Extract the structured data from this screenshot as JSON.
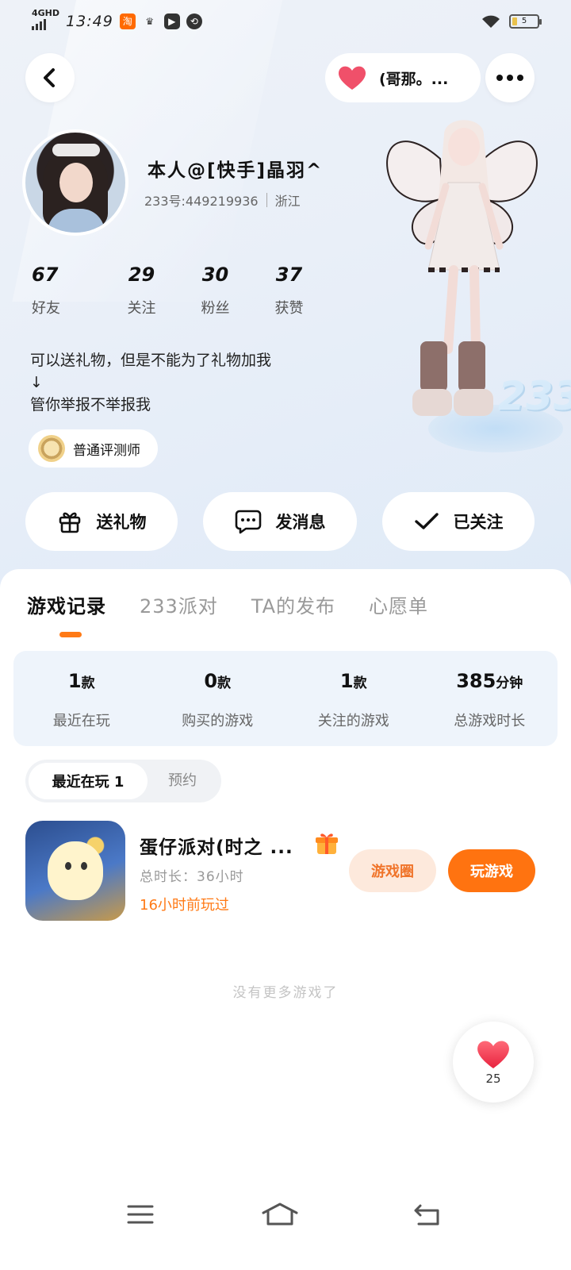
{
  "status_bar": {
    "network": "4GHD",
    "time": "13:49",
    "battery_level": "5"
  },
  "header": {
    "relation_label": "(哥那。...",
    "more_label": "•••"
  },
  "profile": {
    "name": "本人@[快手]晶羽^",
    "uid": "233号:449219936",
    "location": "浙江",
    "stats": [
      {
        "num": "67",
        "label": "好友"
      },
      {
        "num": "29",
        "label": "关注"
      },
      {
        "num": "30",
        "label": "粉丝"
      },
      {
        "num": "37",
        "label": "获赞"
      }
    ],
    "bio_line1": "可以送礼物，但是不能为了礼物加我",
    "bio_line2": "↓",
    "bio_line3": "管你举报不举报我",
    "badge": "普通评测师",
    "deco_text": "233"
  },
  "actions": {
    "gift": "送礼物",
    "message": "发消息",
    "followed": "已关注"
  },
  "tabs": [
    "游戏记录",
    "233派对",
    "TA的发布",
    "心愿单"
  ],
  "summary": [
    {
      "value": "1",
      "unit": "款",
      "label": "最近在玩"
    },
    {
      "value": "0",
      "unit": "款",
      "label": "购买的游戏"
    },
    {
      "value": "1",
      "unit": "款",
      "label": "关注的游戏"
    },
    {
      "value": "385",
      "unit": "分钟",
      "label": "总游戏时长"
    }
  ],
  "segment": {
    "active": "最近在玩 1",
    "inactive": "预约"
  },
  "game": {
    "title": "蛋仔派对(时之 ...",
    "duration": "总时长：36小时",
    "last_played": "16小时前玩过",
    "circle_button": "游戏圈",
    "play_button": "玩游戏"
  },
  "footer_note": "没有更多游戏了",
  "float_like": {
    "count": "25"
  },
  "colors": {
    "accent": "#ff7310",
    "heart": "#f0405a",
    "summary_bg": "#eef4fb"
  }
}
